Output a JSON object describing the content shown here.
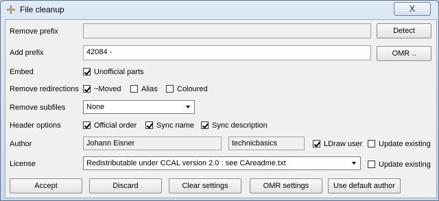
{
  "window": {
    "title": "File cleanup",
    "close_glyph": "X"
  },
  "rows": {
    "remove_prefix": {
      "label": "Remove prefix",
      "value": "",
      "button": "Detect"
    },
    "add_prefix": {
      "label": "Add prefix",
      "value": "42084 -",
      "button": "OMR .."
    },
    "embed": {
      "label": "Embed",
      "unofficial_parts": {
        "label": "Unofficial parts",
        "checked": true
      }
    },
    "remove_redirections": {
      "label": "Remove redirections",
      "moved": {
        "label": "~Moved",
        "checked": true
      },
      "alias": {
        "label": "Alias",
        "checked": false
      },
      "coloured": {
        "label": "Coloured",
        "checked": false
      }
    },
    "remove_subfiles": {
      "label": "Remove subfiles",
      "selected": "None"
    },
    "header_options": {
      "label": "Header options",
      "official_order": {
        "label": "Official order",
        "checked": true
      },
      "sync_name": {
        "label": "Sync name",
        "checked": true
      },
      "sync_description": {
        "label": "Sync description",
        "checked": true
      }
    },
    "author": {
      "label": "Author",
      "name": "Johann Eisner",
      "username": "technicbasics",
      "ldraw_user": {
        "label": "LDraw user",
        "checked": true
      },
      "update_existing": {
        "label": "Update existing",
        "checked": false
      }
    },
    "license": {
      "label": "License",
      "selected": "Redistributable under CCAL version 2.0 : see CAreadme.txt",
      "update_existing": {
        "label": "Update existing",
        "checked": false
      }
    }
  },
  "buttons": {
    "accept": "Accept",
    "discard": "Discard",
    "clear_settings": "Clear settings",
    "omr_settings": "OMR settings",
    "use_default_author": "Use default author"
  },
  "colors": {
    "titlebar": "#c8d9ec",
    "client": "#f0f0f0"
  }
}
